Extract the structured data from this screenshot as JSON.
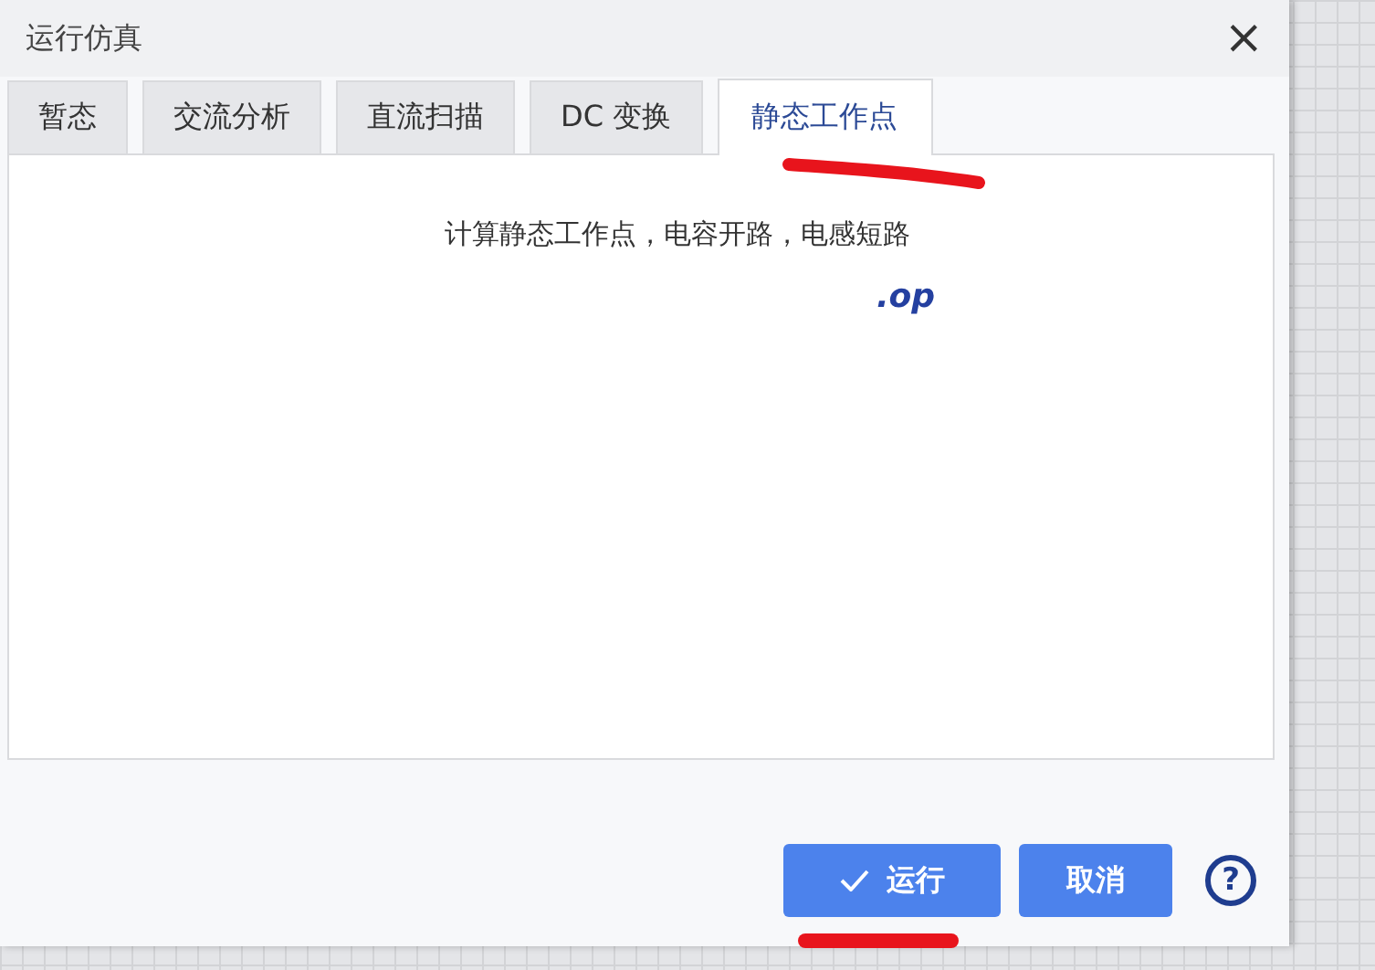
{
  "window": {
    "title": "运行仿真",
    "close": "×"
  },
  "tabs": [
    {
      "label": "暂态",
      "selected": false
    },
    {
      "label": "交流分析",
      "selected": false
    },
    {
      "label": "直流扫描",
      "selected": false
    },
    {
      "label": "DC 变换",
      "selected": false
    },
    {
      "label": "静态工作点",
      "selected": true
    }
  ],
  "panel": {
    "description": "计算静态工作点，电容开路，电感短路",
    "command": ".op"
  },
  "buttons": [
    {
      "label": "运行",
      "kind": "run"
    },
    {
      "label": "取消",
      "kind": "cancel"
    },
    {
      "label": "?",
      "kind": "help"
    }
  ]
}
